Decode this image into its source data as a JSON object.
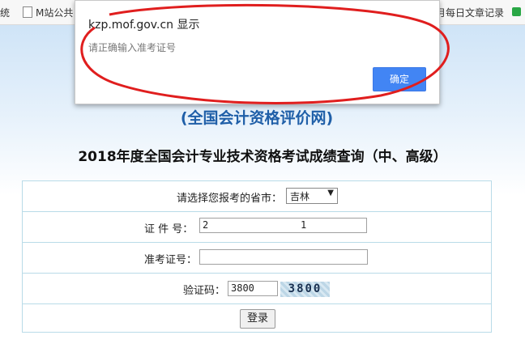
{
  "bookmarks": {
    "left_partial": "统",
    "m_site": "M站公共",
    "right_partial": "月每日文章记录"
  },
  "page": {
    "site_title": "(全国会计资格评价网)",
    "title": "2018年度全国会计专业技术资格考试成绩查询（中、高级）"
  },
  "form": {
    "province_label": "请选择您报考的省市：",
    "province_value": "吉林",
    "cert_label": "证 件 号：",
    "cert_value_start": "2",
    "cert_value_end": "1",
    "exam_label": "准考证号：",
    "exam_value": "",
    "captcha_label": "验证码：",
    "captcha_value": "3800",
    "captcha_image_text": "3800",
    "login_label": "登录"
  },
  "dialog": {
    "title": "kzp.mof.gov.cn 显示",
    "message": "请正确输入准考证号",
    "ok_label": "确定"
  },
  "colors": {
    "accent_blue": "#1f5fa8",
    "dialog_button": "#4285f4",
    "annotation_red": "#e01e1e"
  }
}
